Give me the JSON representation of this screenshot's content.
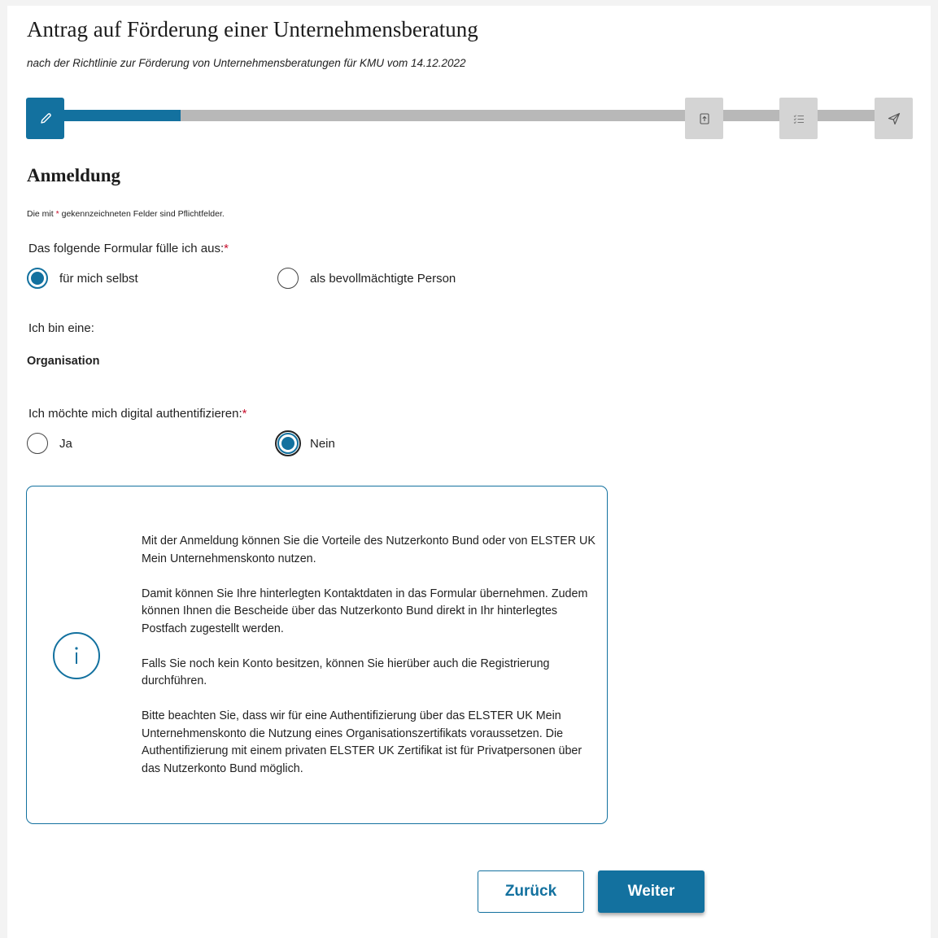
{
  "header": {
    "title": "Antrag auf Förderung einer Unternehmensberatung",
    "subtitle": "nach der Richtlinie zur Förderung von Unternehmensberatungen für KMU vom 14.12.2022"
  },
  "stepper": {
    "progress_fraction": 0.14,
    "steps": [
      {
        "icon": "pencil-icon",
        "state": "active"
      },
      {
        "icon": "upload-icon",
        "state": "inactive"
      },
      {
        "icon": "list-icon",
        "state": "inactive"
      },
      {
        "icon": "send-icon",
        "state": "inactive"
      }
    ]
  },
  "section": {
    "heading": "Anmeldung",
    "hint_before": "Die mit ",
    "hint_star": "*",
    "hint_after": " gekennzeichneten Felder sind Pflichtfelder."
  },
  "question_form_fill": {
    "label": "Das folgende Formular fülle ich aus:",
    "required_mark": "*",
    "options": [
      "für mich selbst",
      "als bevollmächtigte Person"
    ],
    "selected": "für mich selbst"
  },
  "identity": {
    "label": "Ich bin eine:",
    "value": "Organisation"
  },
  "question_auth": {
    "label": "Ich möchte mich digital authentifizieren:",
    "required_mark": "*",
    "options": [
      "Ja",
      "Nein"
    ],
    "selected": "Nein"
  },
  "info_box": {
    "icon": "info-icon",
    "paragraphs": [
      "Mit der Anmeldung können Sie die Vorteile des Nutzerkonto Bund oder von ELSTER UK Mein Unternehmenskonto nutzen.",
      "Damit können Sie Ihre hinterlegten Kontaktdaten in das Formular übernehmen. Zudem können Ihnen die Bescheide über das Nutzerkonto Bund direkt in Ihr hinterlegtes Postfach zugestellt werden.",
      "Falls Sie noch kein Konto besitzen, können Sie hierüber auch die Registrierung durchführen.",
      "Bitte beachten Sie, dass wir für eine Authentifizierung über das ELSTER UK Mein Unternehmenskonto die Nutzung eines Organisationszertifikats voraussetzen. Die Authentifizierung mit einem privaten ELSTER UK Zertifikat ist für Privatpersonen über das Nutzerkonto Bund möglich."
    ]
  },
  "buttons": {
    "back": "Zurück",
    "next": "Weiter"
  },
  "colors": {
    "accent": "#13719f",
    "required": "#c8102e",
    "track": "#b8b8b8",
    "step_inactive": "#d4d4d4"
  }
}
